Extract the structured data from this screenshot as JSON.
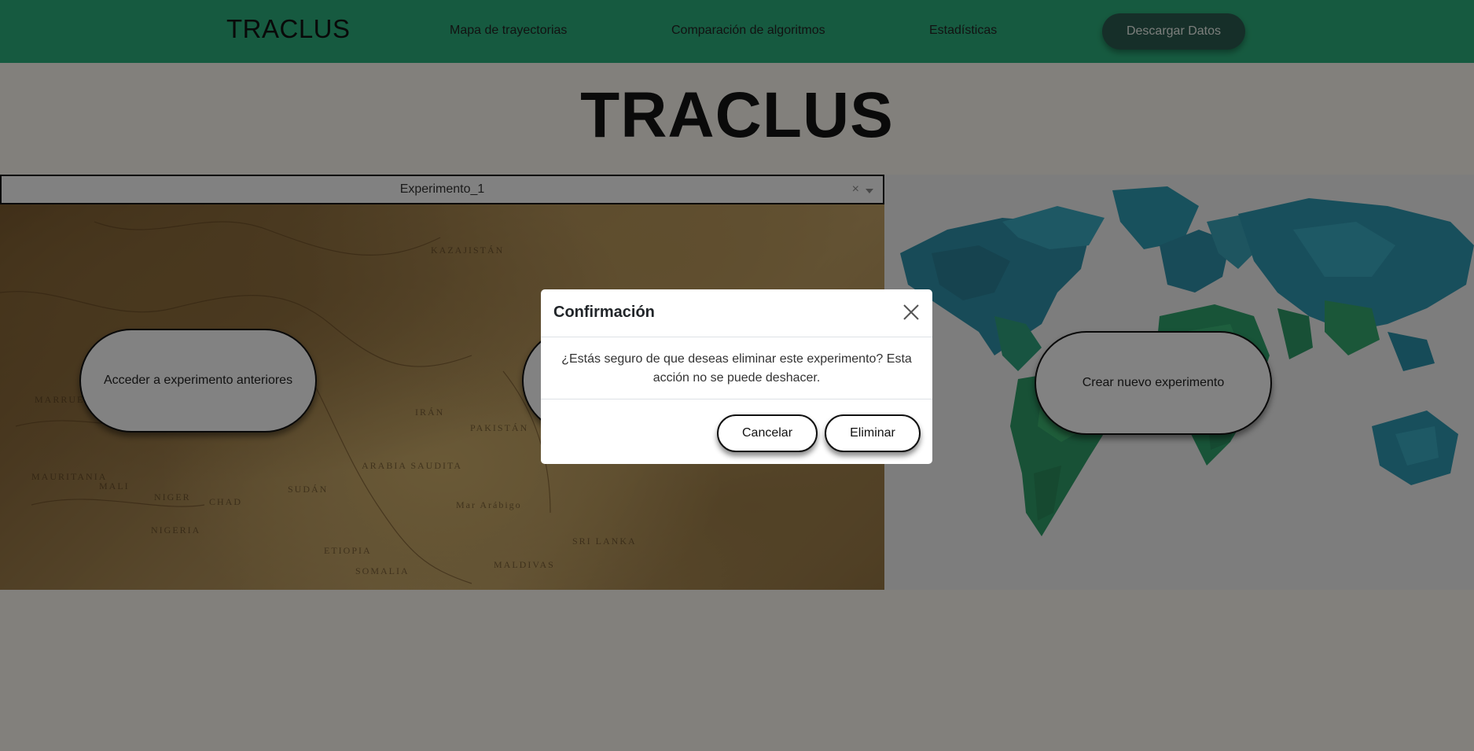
{
  "navbar": {
    "brand": "TRACLUS",
    "links": [
      "Mapa de trayectorias",
      "Comparación de algoritmos",
      "Estadísticas"
    ],
    "download_label": "Descargar Datos"
  },
  "hero": {
    "title": "TRACLUS"
  },
  "experiment_selector": {
    "value": "Experimento_1",
    "clear_symbol": "×"
  },
  "left_panel": {
    "button_label": "Acceder a experimento anteriores",
    "map_labels": [
      "KAZAJISTÁN",
      "IRÁN",
      "ARABIA SAUDITA",
      "SUDÁN",
      "MALI",
      "NIGER",
      "CHAD",
      "NIGERIA",
      "ETIOPIA",
      "SOMALIA",
      "MAURITANIA",
      "MARRUECOS",
      "PAKISTÁN",
      "MALDIVAS",
      "SRI LANKA",
      "Mar Arábigo"
    ]
  },
  "right_panel": {
    "button_label": "Crear nuevo experimento"
  },
  "modal": {
    "title": "Confirmación",
    "message": "¿Estás seguro de que deseas eliminar este experimento? Esta acción no se puede deshacer.",
    "cancel_label": "Cancelar",
    "delete_label": "Eliminar"
  },
  "colors": {
    "navbar": "#2bab79",
    "download_button": "#2a5a4f",
    "map_teal": "#2e9bb0",
    "map_green": "#35a865"
  }
}
